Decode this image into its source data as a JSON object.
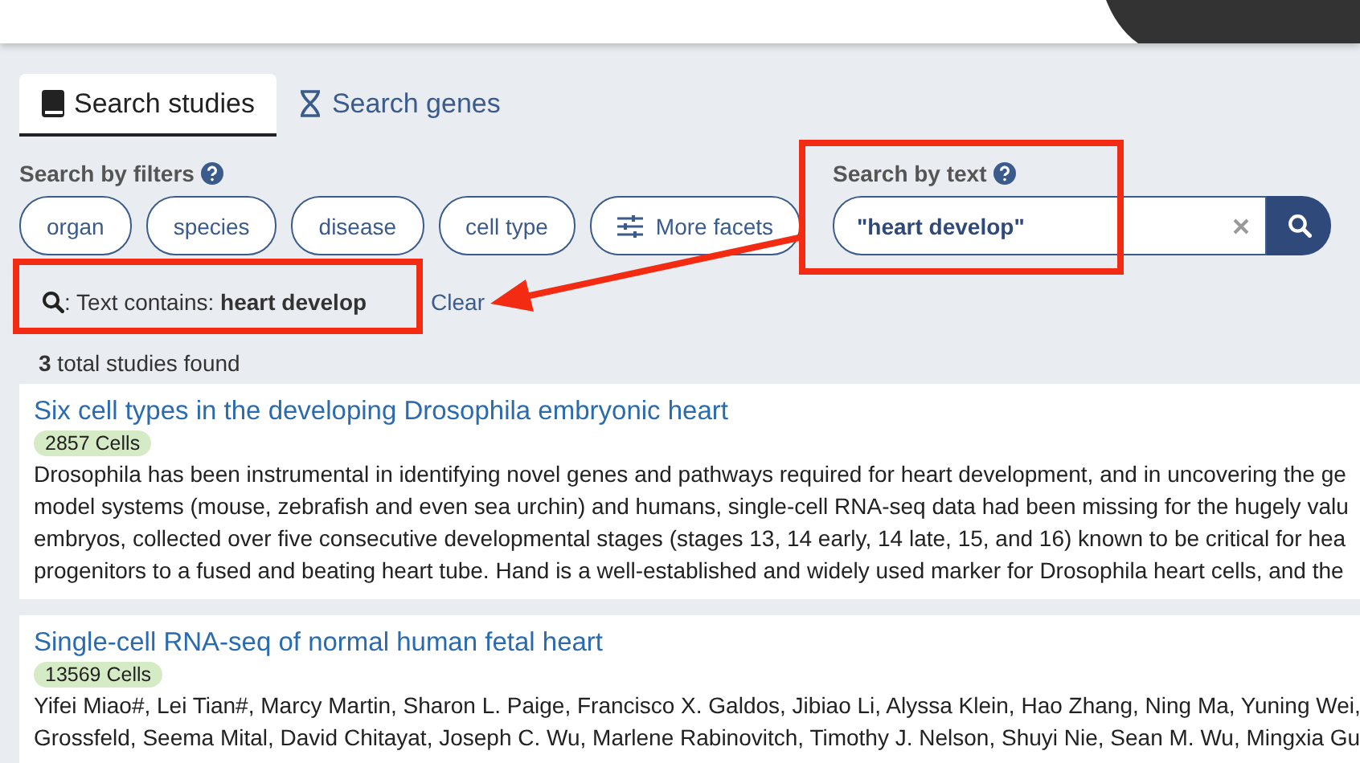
{
  "tabs": [
    {
      "label": "Search studies",
      "selected": true
    },
    {
      "label": "Search genes",
      "selected": false
    }
  ],
  "filters": {
    "label": "Search by filters",
    "facets": [
      {
        "label": "organ",
        "kind": "pill"
      },
      {
        "label": "species",
        "kind": "pill"
      },
      {
        "label": "disease",
        "kind": "pill"
      },
      {
        "label": "cell type",
        "kind": "pill"
      },
      {
        "label": "More facets",
        "kind": "more"
      }
    ]
  },
  "text_search": {
    "label": "Search by text",
    "value": "\"heart develop\""
  },
  "active_filter": {
    "prefix": ": Text contains: ",
    "term": "heart develop",
    "clear": "Clear"
  },
  "results": {
    "count": "3",
    "count_label": " total studies found",
    "studies": [
      {
        "title": "Six cell types in the developing Drosophila embryonic heart",
        "cells": "2857 Cells",
        "lines": [
          "Drosophila has been instrumental in identifying novel genes and pathways required for heart development, and in uncovering the ge",
          "model systems (mouse, zebrafish and even sea urchin) and humans, single-cell RNA-seq data had been missing for the hugely valu",
          "embryos, collected over five consecutive developmental stages (stages 13, 14 early, 14 late, 15, and 16) known to be critical for hea",
          "progenitors to a fused and beating heart tube. Hand is a well-established and widely used marker for Drosophila heart cells, and the"
        ]
      },
      {
        "title": "Single-cell RNA-seq of normal human fetal heart",
        "cells": "13569 Cells",
        "lines": [
          "Yifei Miao#, Lei Tian#, Marcy Martin, Sharon L. Paige, Francisco X. Galdos, Jibiao Li, Alyssa Klein, Hao Zhang, Ning Ma, Yuning Wei,",
          "Grossfeld, Seema Mital, David Chitayat, Joseph C. Wu, Marlene Rabinovitch, Timothy J. Nelson, Shuyi Nie, Sean M. Wu, Mingxia Gu"
        ]
      }
    ]
  }
}
